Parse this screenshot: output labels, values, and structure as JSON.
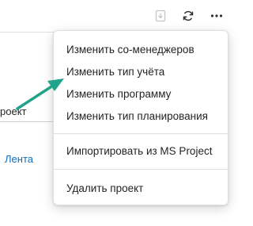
{
  "toolbar": {
    "buttons": [
      {
        "name": "download-button",
        "icon": "download-icon"
      },
      {
        "name": "refresh-button",
        "icon": "refresh-icon"
      },
      {
        "name": "more-button",
        "icon": "more-horizontal-icon"
      }
    ]
  },
  "background": {
    "project_text": "роект",
    "lenta_link": "Лента"
  },
  "menu": {
    "items": [
      {
        "label": "Изменить со-менеджеров"
      },
      {
        "label": "Изменить тип учёта"
      },
      {
        "label": "Изменить программу"
      },
      {
        "label": "Изменить тип планирования"
      },
      {
        "label": "Импортировать из MS Project"
      },
      {
        "label": "Удалить проект"
      }
    ]
  },
  "colors": {
    "arrow": "#1fa38a",
    "link": "#0f6cbd"
  }
}
